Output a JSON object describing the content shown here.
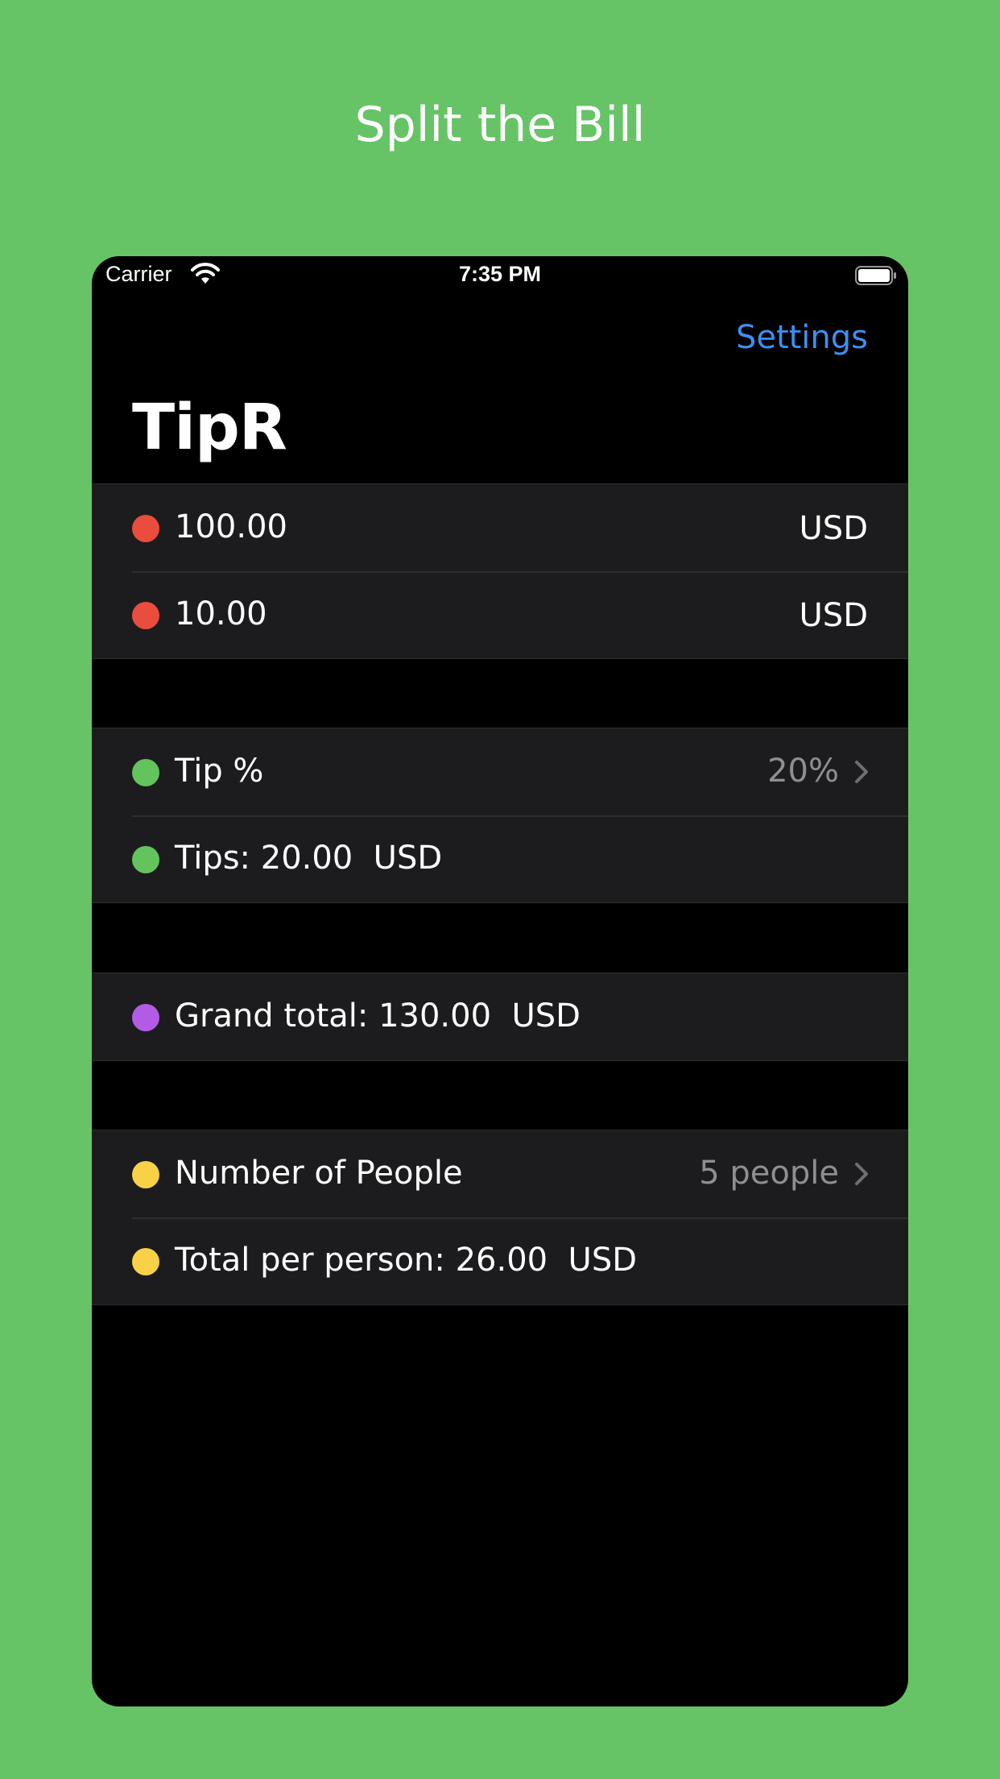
{
  "promo": {
    "title": "Split the Bill"
  },
  "status_bar": {
    "carrier": "Carrier",
    "time": "7:35 PM"
  },
  "nav": {
    "settings_label": "Settings",
    "title": "TipR"
  },
  "bill_section": {
    "rows": [
      {
        "value": "100.00",
        "currency": "USD",
        "dot_color": "#ea4d3d"
      },
      {
        "value": "10.00",
        "currency": "USD",
        "dot_color": "#ea4d3d"
      }
    ]
  },
  "tip_section": {
    "tip_percent_label": "Tip %",
    "tip_percent_value": "20%",
    "tips_label": "Tips: 20.00  USD",
    "dot_color": "#63c35d"
  },
  "total_section": {
    "grand_total_label": "Grand total: 130.00  USD",
    "dot_color": "#b45be6"
  },
  "people_section": {
    "people_label": "Number of People",
    "people_value": "5 people",
    "per_person_label": "Total per person: 26.00  USD",
    "dot_color": "#f8d147"
  },
  "colors": {
    "background": "#66c466",
    "accent": "#3f8ef1",
    "cell": "#1c1c1e"
  },
  "icons": {
    "wifi": "wifi-icon",
    "battery": "battery-icon",
    "chevron": "chevron-right-icon"
  }
}
